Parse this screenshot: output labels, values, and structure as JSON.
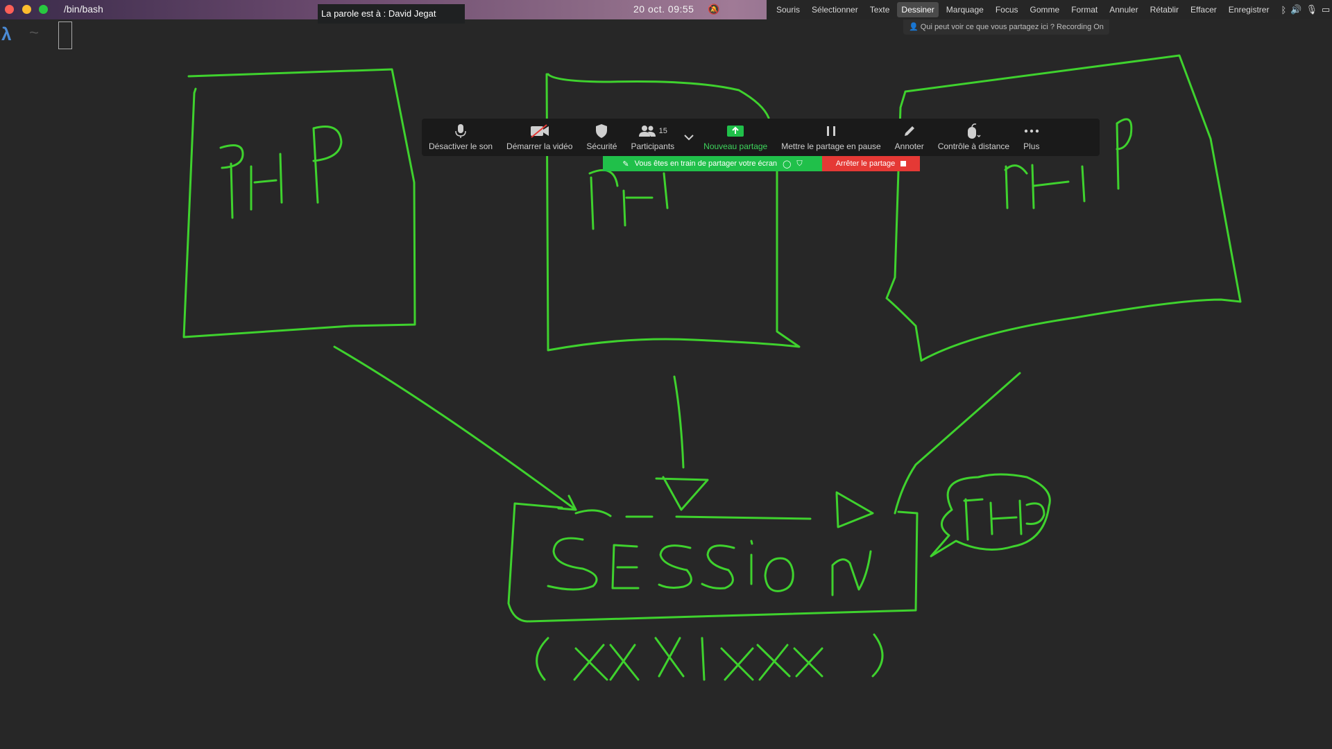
{
  "window": {
    "title": "/bin/bash",
    "speaker": "La parole est à : David Jegat",
    "clock": "20 oct.  09:55"
  },
  "menubar": {
    "items": [
      "Souris",
      "Sélectionner",
      "Texte",
      "Dessiner",
      "Marquage",
      "Focus",
      "Gomme",
      "Format",
      "Annuler",
      "Rétablir",
      "Effacer",
      "Enregistrer"
    ],
    "active": "Dessiner"
  },
  "share_notice": "Qui peut voir ce que vous partagez ici ? Recording On",
  "terminal": {
    "prompt_symbol": "λ",
    "dir": "~"
  },
  "toolbar": {
    "mute": "Désactiver le son",
    "video": "Démarrer la vidéo",
    "security": "Sécurité",
    "participants": "Participants",
    "participants_count": "15",
    "new_share": "Nouveau partage",
    "pause_share": "Mettre le partage en pause",
    "annotate": "Annoter",
    "remote_control": "Contrôle à distance",
    "more": "Plus"
  },
  "sharing_bar": {
    "status": "Vous êtes en train de partager votre écran",
    "stop": "Arrêter le partage"
  },
  "colors": {
    "ink": "#3fd22e",
    "share_green": "#20c04a",
    "stop_red": "#e53935",
    "accent": "#4a8ad4"
  }
}
